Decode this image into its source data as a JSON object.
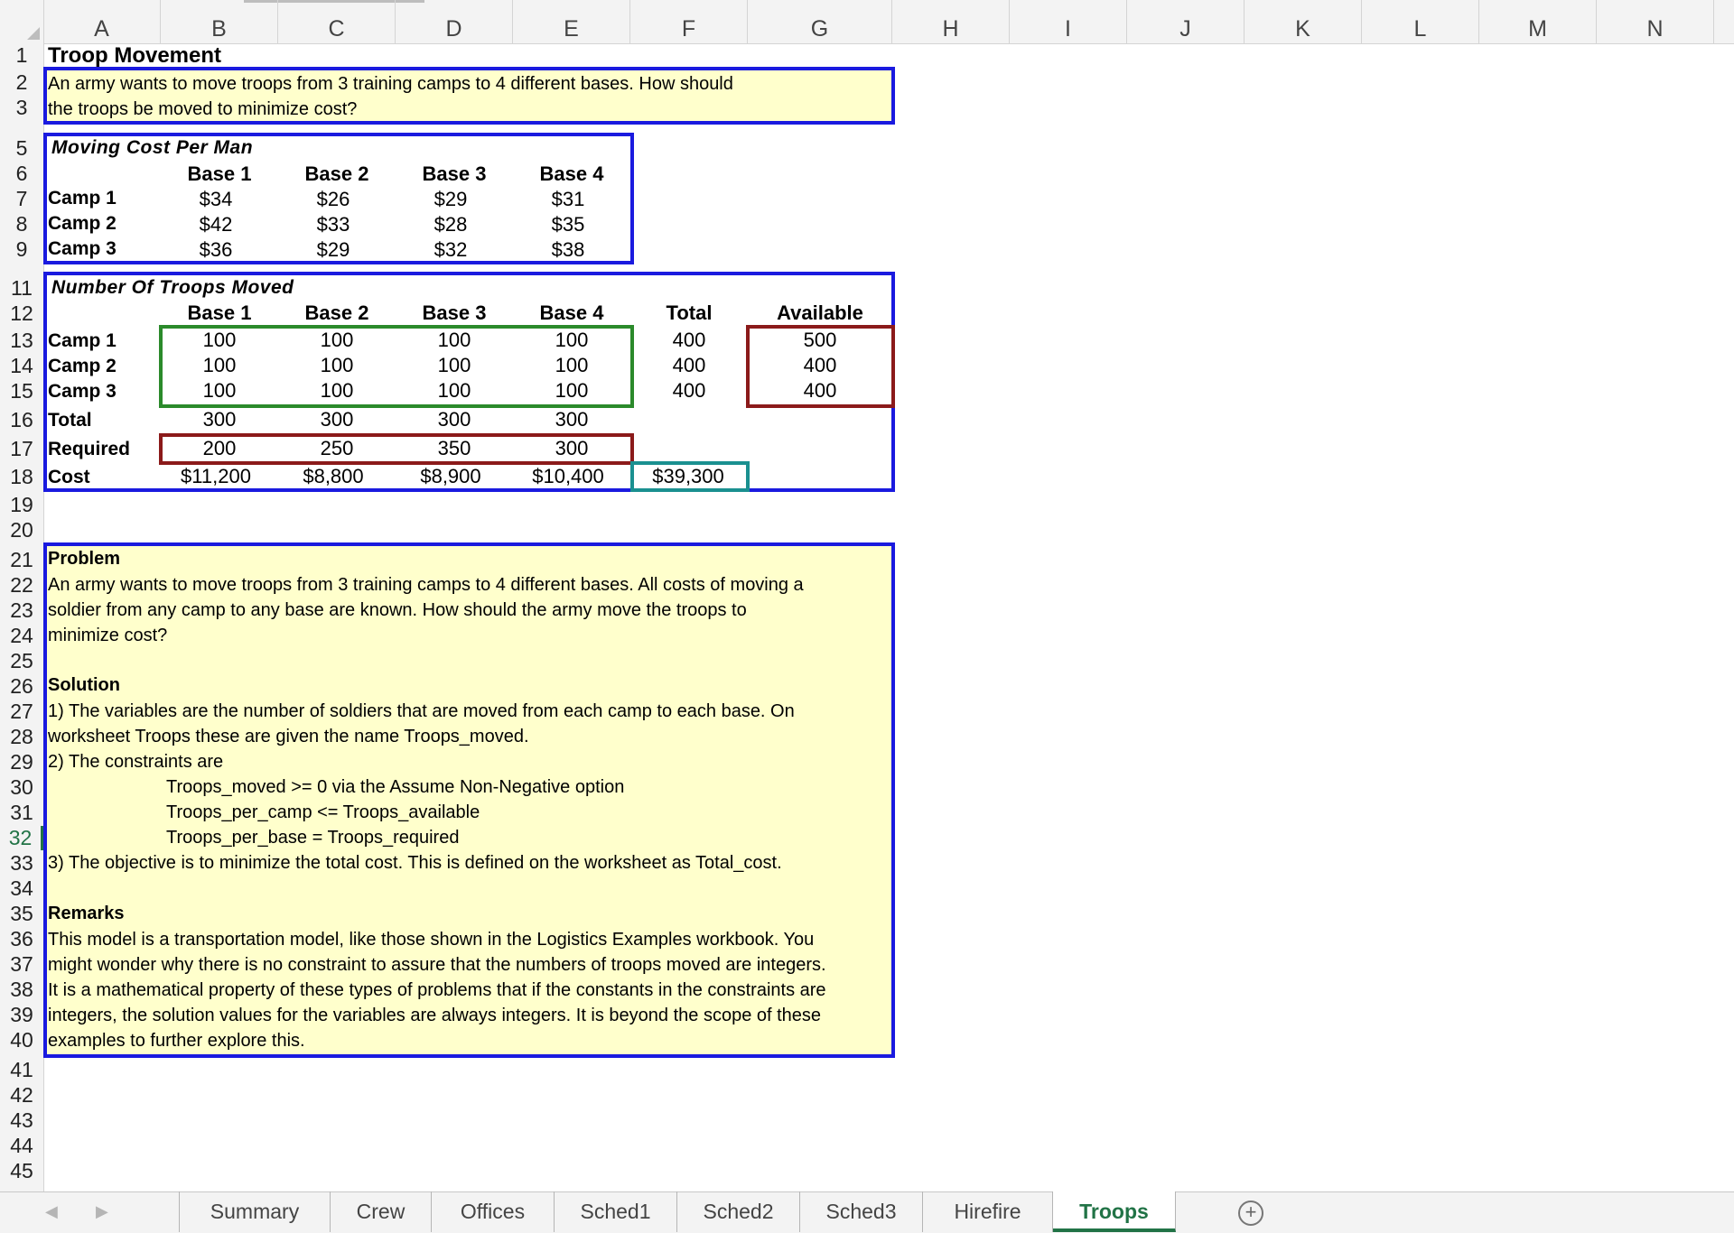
{
  "columns": [
    "A",
    "B",
    "C",
    "D",
    "E",
    "F",
    "G",
    "H",
    "I",
    "J",
    "K",
    "L",
    "M",
    "N"
  ],
  "rows": [
    "1",
    "2",
    "3",
    "5",
    "6",
    "7",
    "8",
    "9",
    "11",
    "12",
    "13",
    "14",
    "15",
    "16",
    "17",
    "18",
    "19",
    "20",
    "21",
    "22",
    "23",
    "24",
    "25",
    "26",
    "27",
    "28",
    "29",
    "30",
    "31",
    "32",
    "33",
    "34",
    "35",
    "36",
    "37",
    "38",
    "39",
    "40",
    "41",
    "42",
    "43",
    "44",
    "45"
  ],
  "selected_row": "32",
  "sheet": {
    "title": "Troop Movement",
    "intro_line1": "An army wants to move troops from 3 training camps to 4 different bases. How should",
    "intro_line2": "the troops be moved to minimize cost?",
    "cost_table": {
      "heading": "Moving Cost Per Man",
      "headers": [
        "Base 1",
        "Base 2",
        "Base 3",
        "Base 4"
      ],
      "rows": [
        {
          "label": "Camp 1",
          "values": [
            "$34",
            "$26",
            "$29",
            "$31"
          ]
        },
        {
          "label": "Camp 2",
          "values": [
            "$42",
            "$33",
            "$28",
            "$35"
          ]
        },
        {
          "label": "Camp 3",
          "values": [
            "$36",
            "$29",
            "$32",
            "$38"
          ]
        }
      ]
    },
    "troops_table": {
      "heading": "Number Of Troops Moved",
      "headers": [
        "Base 1",
        "Base 2",
        "Base 3",
        "Base 4"
      ],
      "total_header": "Total",
      "available_header": "Available",
      "rows": [
        {
          "label": "Camp 1",
          "values": [
            "100",
            "100",
            "100",
            "100"
          ],
          "total": "400",
          "available": "500"
        },
        {
          "label": "Camp 2",
          "values": [
            "100",
            "100",
            "100",
            "100"
          ],
          "total": "400",
          "available": "400"
        },
        {
          "label": "Camp 3",
          "values": [
            "100",
            "100",
            "100",
            "100"
          ],
          "total": "400",
          "available": "400"
        }
      ],
      "total_label": "Total",
      "totals": [
        "300",
        "300",
        "300",
        "300"
      ],
      "required_label": "Required",
      "required": [
        "200",
        "250",
        "350",
        "300"
      ],
      "cost_label": "Cost",
      "costs": [
        "$11,200",
        "$8,800",
        "$8,900",
        "$10,400"
      ],
      "total_cost": "$39,300"
    },
    "notes": {
      "problem_heading": "Problem",
      "problem": [
        "An army wants to move troops from 3 training camps to 4 different bases. All costs of moving a",
        "soldier from any camp to any base are known. How should the army move the troops to",
        "minimize cost?"
      ],
      "solution_heading": "Solution",
      "solution": [
        "1) The variables are the number of soldiers that are moved from each camp to each base.  On",
        "worksheet Troops these are given the name Troops_moved.",
        "2) The constraints are"
      ],
      "constraints": [
        "Troops_moved >= 0  via the Assume Non-Negative option",
        "Troops_per_camp <= Troops_available",
        "Troops_per_base = Troops_required"
      ],
      "objective": "3) The objective is to minimize the total cost. This is defined on the worksheet as Total_cost.",
      "remarks_heading": "Remarks",
      "remarks": [
        "This model is a transportation model, like those shown in the Logistics Examples workbook. You",
        "might wonder why there is no constraint to assure that the numbers of troops moved are integers.",
        "It is a mathematical property of these types of problems that if the constants in the constraints are",
        "integers, the solution values for the variables are always integers. It is beyond the scope of these",
        "examples to further explore this."
      ]
    }
  },
  "tabs": [
    "Summary",
    "Crew",
    "Offices",
    "Sched1",
    "Sched2",
    "Sched3",
    "Hirefire",
    "Troops"
  ],
  "active_tab": "Troops",
  "add_sheet_symbol": "+",
  "colors": {
    "blue_box": "#1a1adf",
    "green_box": "#2b8a2b",
    "maroon_box": "#8b1a1a",
    "teal_box": "#1a9090",
    "note_fill": "#ffffcc",
    "active_tab": "#217346"
  }
}
